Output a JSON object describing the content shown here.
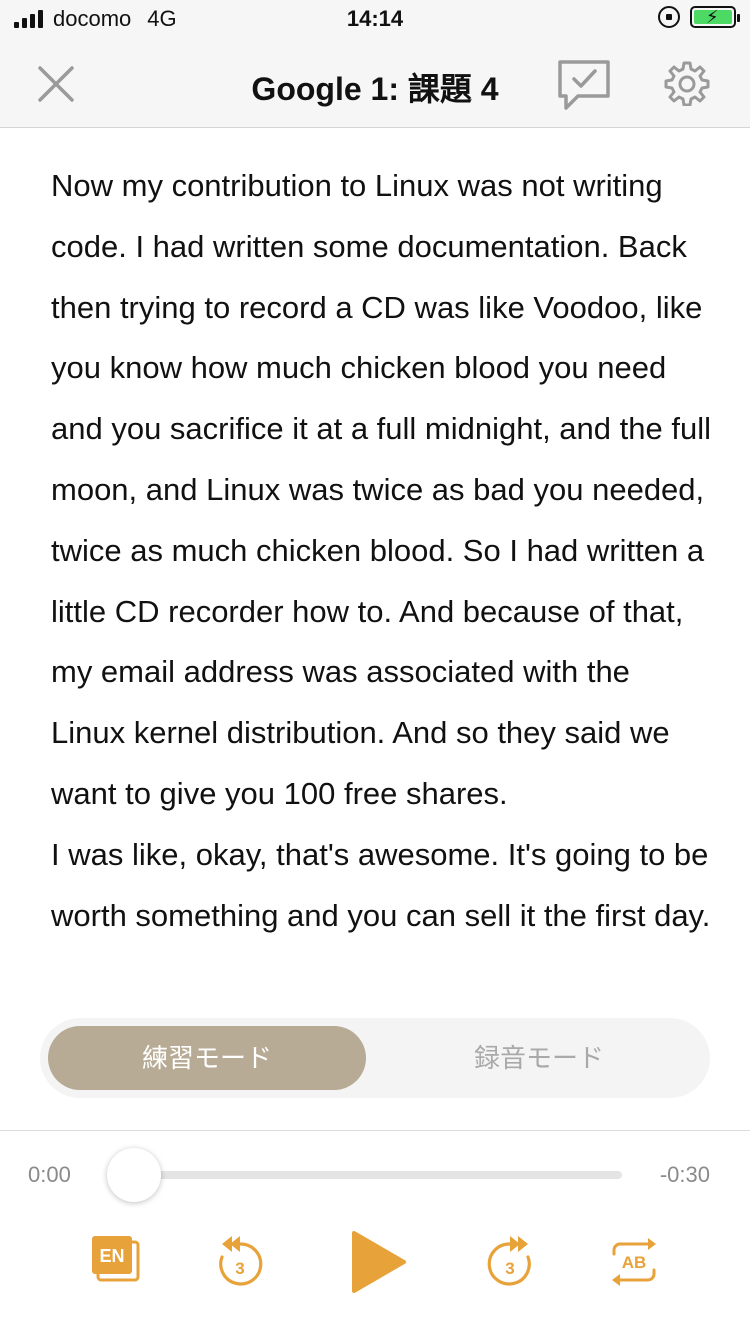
{
  "status_bar": {
    "carrier": "docomo",
    "network": "4G",
    "time": "14:14"
  },
  "nav": {
    "title": "Google 1: 課題 4"
  },
  "transcript": {
    "paragraphs": [
      "Now my contribution to Linux was not writing code. I had written some documentation. Back then trying to record a CD was like Voodoo, like you know how much chicken blood you need and you sacrifice it at a full midnight, and the full moon, and Linux was twice as bad you needed, twice as much chicken blood. So I had written a little CD recorder how to. And because of that, my email address was associated with the Linux kernel distribution. And so they said we want to give you 100 free shares.",
      "I was like, okay, that's awesome. It's going to be worth something and you can sell it the first day."
    ]
  },
  "mode_toggle": {
    "practice_label": "練習モード",
    "record_label": "録音モード",
    "selected": "practice"
  },
  "player": {
    "elapsed": "0:00",
    "remaining": "-0:30",
    "progress": 0,
    "en_label": "EN",
    "rewind_seconds": "3",
    "forward_seconds": "3",
    "ab_label": "AB",
    "accent_color": "#e8a23a"
  }
}
